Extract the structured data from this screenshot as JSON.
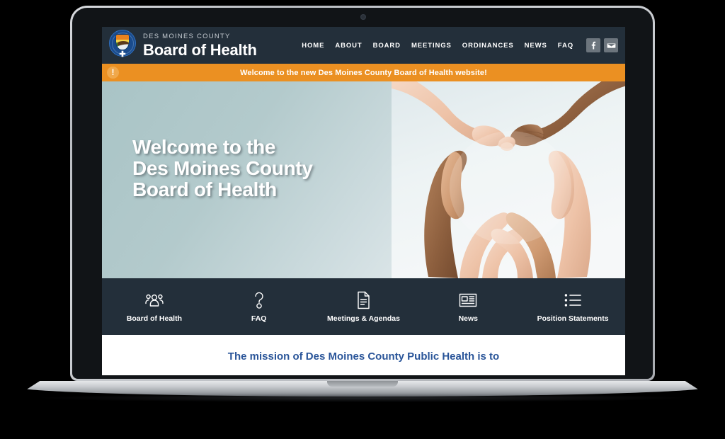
{
  "device": {
    "type": "laptop-mockup",
    "webcam": "webcam-dot"
  },
  "header": {
    "logo": {
      "alt": "Des Moines County Public Health seal",
      "cross_glyph": "✚"
    },
    "brand_kicker": "DES MOINES COUNTY",
    "brand_title": "Board of Health",
    "nav": [
      {
        "label": "HOME",
        "name": "nav-home"
      },
      {
        "label": "ABOUT",
        "name": "nav-about"
      },
      {
        "label": "BOARD",
        "name": "nav-board"
      },
      {
        "label": "MEETINGS",
        "name": "nav-meetings"
      },
      {
        "label": "ORDINANCES",
        "name": "nav-ordinances"
      },
      {
        "label": "NEWS",
        "name": "nav-news"
      },
      {
        "label": "FAQ",
        "name": "nav-faq"
      }
    ],
    "social": [
      {
        "label": "f",
        "name": "facebook-icon"
      },
      {
        "label": "envelope",
        "name": "email-icon"
      }
    ],
    "background_color": "#232f3a"
  },
  "alert": {
    "icon": "!",
    "text": "Welcome to the new Des Moines County Board of Health website!",
    "background_color": "#eb9022",
    "text_color": "#ffffff"
  },
  "hero": {
    "heading_line1": "Welcome to the",
    "heading_line2": "Des Moines County",
    "heading_line3": "Board of Health",
    "image_alt": "Four hands of different skin tones forming a heart shape against a pale sky background",
    "background_gradient_start": "#a9c4c6",
    "background_gradient_end": "#f2f5f6"
  },
  "quick_links": {
    "background_color": "#232f3a",
    "items": [
      {
        "label": "Board of Health",
        "icon": "people-icon"
      },
      {
        "label": "FAQ",
        "icon": "question-mark-icon"
      },
      {
        "label": "Meetings & Agendas",
        "icon": "document-icon"
      },
      {
        "label": "News",
        "icon": "newspaper-icon"
      },
      {
        "label": "Position Statements",
        "icon": "list-icon"
      }
    ]
  },
  "mission": {
    "text": "The mission of Des Moines County Public Health is to",
    "text_color": "#2a5599"
  }
}
